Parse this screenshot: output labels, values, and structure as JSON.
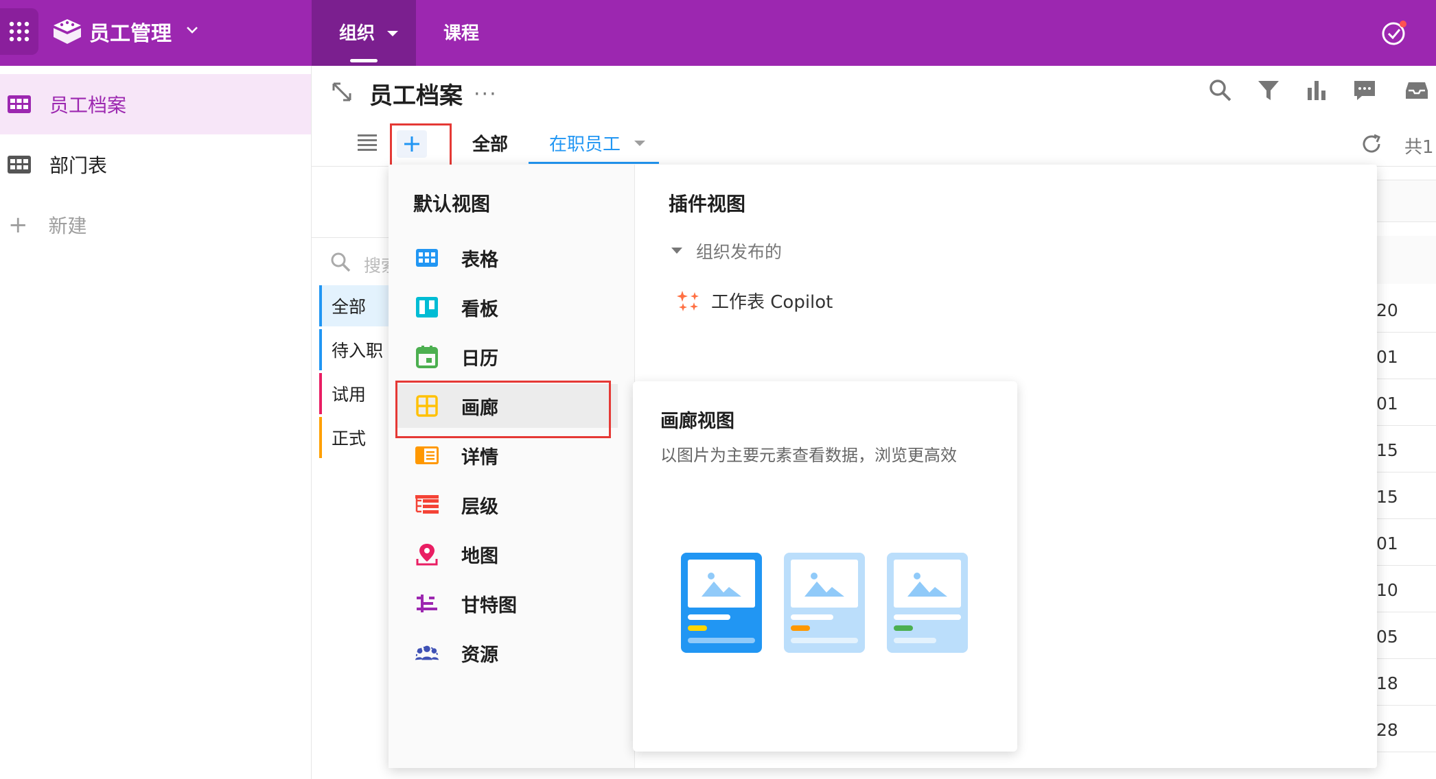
{
  "app": {
    "title": "员工管理",
    "nav_tabs": [
      {
        "label": "组织",
        "active": true
      },
      {
        "label": "课程",
        "active": false
      }
    ]
  },
  "sidebar": {
    "items": [
      {
        "label": "员工档案",
        "active": true,
        "icon": "grid-table-icon"
      },
      {
        "label": "部门表",
        "active": false,
        "icon": "grid-table-icon"
      }
    ],
    "new_label": "新建"
  },
  "worksheet": {
    "title": "员工档案",
    "view_tabs": [
      {
        "label": "全部",
        "active": false
      },
      {
        "label": "在职员工",
        "active": true
      }
    ],
    "total_prefix": "共1"
  },
  "filter_panel": {
    "search_placeholder": "搜索",
    "items": [
      {
        "label": "全部",
        "color": "#2196f3"
      },
      {
        "label": "待入职",
        "color": "#2196f3"
      },
      {
        "label": "试用",
        "color": "#e91e63"
      },
      {
        "label": "正式",
        "color": "#ffa000"
      }
    ]
  },
  "table_fragment": {
    "values": [
      "20",
      "01",
      "01",
      "15",
      "15",
      "01",
      "10",
      "05",
      "18",
      "28"
    ]
  },
  "add_view_menu": {
    "default_section_title": "默认视图",
    "default_views": [
      {
        "label": "表格",
        "icon": "table-view-icon",
        "color": "#2196f3"
      },
      {
        "label": "看板",
        "icon": "kanban-view-icon",
        "color": "#00bcd4"
      },
      {
        "label": "日历",
        "icon": "calendar-view-icon",
        "color": "#4caf50"
      },
      {
        "label": "画廊",
        "icon": "gallery-view-icon",
        "color": "#ffc107"
      },
      {
        "label": "详情",
        "icon": "detail-view-icon",
        "color": "#ff9800"
      },
      {
        "label": "层级",
        "icon": "hierarchy-view-icon",
        "color": "#f44336"
      },
      {
        "label": "地图",
        "icon": "map-view-icon",
        "color": "#e91e63"
      },
      {
        "label": "甘特图",
        "icon": "gantt-view-icon",
        "color": "#9c27b0"
      },
      {
        "label": "资源",
        "icon": "resource-view-icon",
        "color": "#3f51b5"
      }
    ],
    "plugin_section_title": "插件视图",
    "plugin_group_label": "组织发布的",
    "plugin_items": [
      {
        "label": "工作表 Copilot",
        "icon": "copilot-sparkle-icon"
      }
    ]
  },
  "gallery_tooltip": {
    "title": "画廊视图",
    "description": "以图片为主要元素查看数据，浏览更高效"
  },
  "colors": {
    "topbar": "#9c27b0",
    "accent_blue": "#2196f3",
    "highlight_red": "#e53935"
  }
}
